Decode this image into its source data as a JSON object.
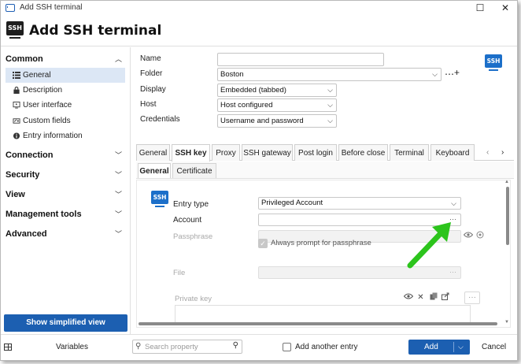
{
  "window": {
    "title": "Add SSH terminal",
    "heading": "Add SSH terminal",
    "badge": "SSH"
  },
  "sidebar": {
    "sections": [
      {
        "label": "Common",
        "expanded": true
      },
      {
        "label": "Connection",
        "expanded": false
      },
      {
        "label": "Security",
        "expanded": false
      },
      {
        "label": "View",
        "expanded": false
      },
      {
        "label": "Management tools",
        "expanded": false
      },
      {
        "label": "Advanced",
        "expanded": false
      }
    ],
    "items": [
      {
        "label": "General",
        "selected": true,
        "icon": "list-icon"
      },
      {
        "label": "Description",
        "icon": "lock-icon"
      },
      {
        "label": "User interface",
        "icon": "monitor-icon"
      },
      {
        "label": "Custom fields",
        "icon": "custom-fields-icon"
      },
      {
        "label": "Entry information",
        "icon": "info-icon"
      }
    ],
    "simplified_button": "Show simplified view"
  },
  "form": {
    "name_label": "Name",
    "name_value": "",
    "folder_label": "Folder",
    "folder_value": "Boston",
    "display_label": "Display",
    "display_value": "Embedded (tabbed)",
    "host_label": "Host",
    "host_value": "Host configured",
    "credentials_label": "Credentials",
    "credentials_value": "Username and password"
  },
  "tabs": [
    {
      "label": "General"
    },
    {
      "label": "SSH key",
      "active": true
    },
    {
      "label": "Proxy"
    },
    {
      "label": "SSH gateway"
    },
    {
      "label": "Post login"
    },
    {
      "label": "Before close"
    },
    {
      "label": "Terminal"
    },
    {
      "label": "Keyboard"
    }
  ],
  "subtabs": [
    {
      "label": "General",
      "active": true
    },
    {
      "label": "Certificate"
    }
  ],
  "sshkey_panel": {
    "badge": "SSH",
    "entry_type_label": "Entry type",
    "entry_type_value": "Privileged Account",
    "account_label": "Account",
    "account_value": "",
    "passphrase_label": "Passphrase",
    "always_prompt_label": "Always prompt for passphrase",
    "always_prompt_checked": true,
    "file_label": "File",
    "private_key_label": "Private key"
  },
  "footer": {
    "variables_label": "Variables",
    "search_placeholder": "Search property",
    "add_another_label": "Add another entry",
    "add_another_checked": false,
    "add_label": "Add",
    "cancel_label": "Cancel"
  },
  "colors": {
    "accent": "#1c5fb1",
    "selected_bg": "#dce7f5",
    "annotation_arrow": "#2cc41c"
  }
}
